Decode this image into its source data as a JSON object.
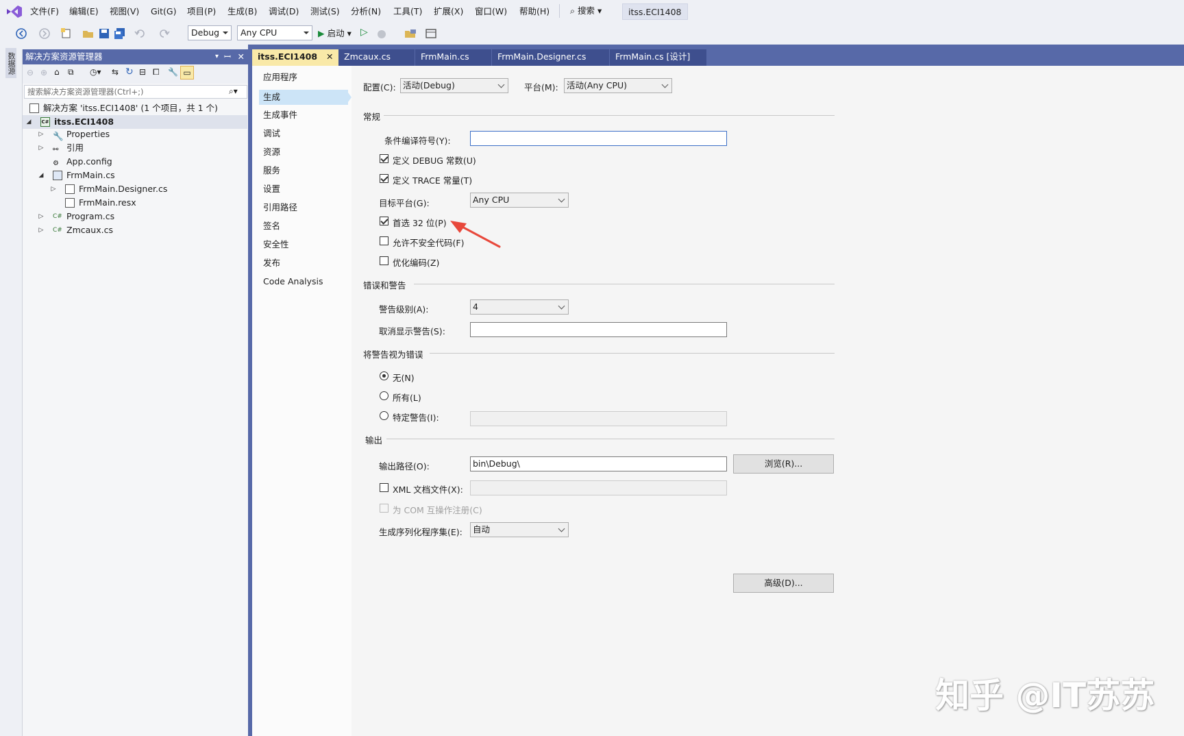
{
  "menubar": {
    "items": [
      "文件(F)",
      "编辑(E)",
      "视图(V)",
      "Git(G)",
      "项目(P)",
      "生成(B)",
      "调试(D)",
      "测试(S)",
      "分析(N)",
      "工具(T)",
      "扩展(X)",
      "窗口(W)",
      "帮助(H)"
    ],
    "search_label": "搜索",
    "solution_title": "itss.ECI1408"
  },
  "toolbar": {
    "config": "Debug",
    "platform": "Any CPU",
    "start_label": "启动"
  },
  "leftstrip": {
    "tab_label": "数据源"
  },
  "solution_explorer": {
    "title": "解决方案资源管理器",
    "search_placeholder": "搜索解决方案资源管理器(Ctrl+;)",
    "tree": [
      "解决方案 'itss.ECI1408' (1 个项目，共 1 个)",
      "itss.ECI1408",
      "Properties",
      "引用",
      "App.config",
      "FrmMain.cs",
      "FrmMain.Designer.cs",
      "FrmMain.resx",
      "Program.cs",
      "Zmcaux.cs"
    ]
  },
  "tabs": [
    "itss.ECI1408",
    "Zmcaux.cs",
    "FrmMain.cs",
    "FrmMain.Designer.cs",
    "FrmMain.cs [设计]"
  ],
  "nav": [
    "应用程序",
    "生成",
    "生成事件",
    "调试",
    "资源",
    "服务",
    "设置",
    "引用路径",
    "签名",
    "安全性",
    "发布",
    "Code Analysis"
  ],
  "build": {
    "config_label": "配置(C):",
    "config_value": "活动(Debug)",
    "platform_label": "平台(M):",
    "platform_value": "活动(Any CPU)",
    "general_section": "常规",
    "cond_symbols_label": "条件编译符号(Y):",
    "cond_symbols_value": "",
    "define_debug": "定义 DEBUG 常数(U)",
    "define_trace": "定义 TRACE 常量(T)",
    "target_platform_label": "目标平台(G):",
    "target_platform_value": "Any CPU",
    "prefer32": "首选 32 位(P)",
    "unsafe": "允许不安全代码(F)",
    "optimize": "优化编码(Z)",
    "errors_section": "错误和警告",
    "warn_level_label": "警告级别(A):",
    "warn_level_value": "4",
    "suppress_label": "取消显示警告(S):",
    "suppress_value": "",
    "treat_section": "将警告视为错误",
    "radio_none": "无(N)",
    "radio_all": "所有(L)",
    "radio_specific": "特定警告(I):",
    "output_section": "输出",
    "output_path_label": "输出路径(O):",
    "output_path_value": "bin\\Debug\\",
    "browse_button": "浏览(R)...",
    "xml_doc": "XML 文档文件(X):",
    "com_register": "为 COM 互操作注册(C)",
    "serialization_label": "生成序列化程序集(E):",
    "serialization_value": "自动",
    "advanced_button": "高级(D)..."
  },
  "watermark": "知乎 @IT苏苏",
  "colors": {
    "accent": "#5769a8",
    "active_tab": "#f9e9a8",
    "nav_selected": "#cce4f7",
    "arrow": "#e8483b"
  }
}
